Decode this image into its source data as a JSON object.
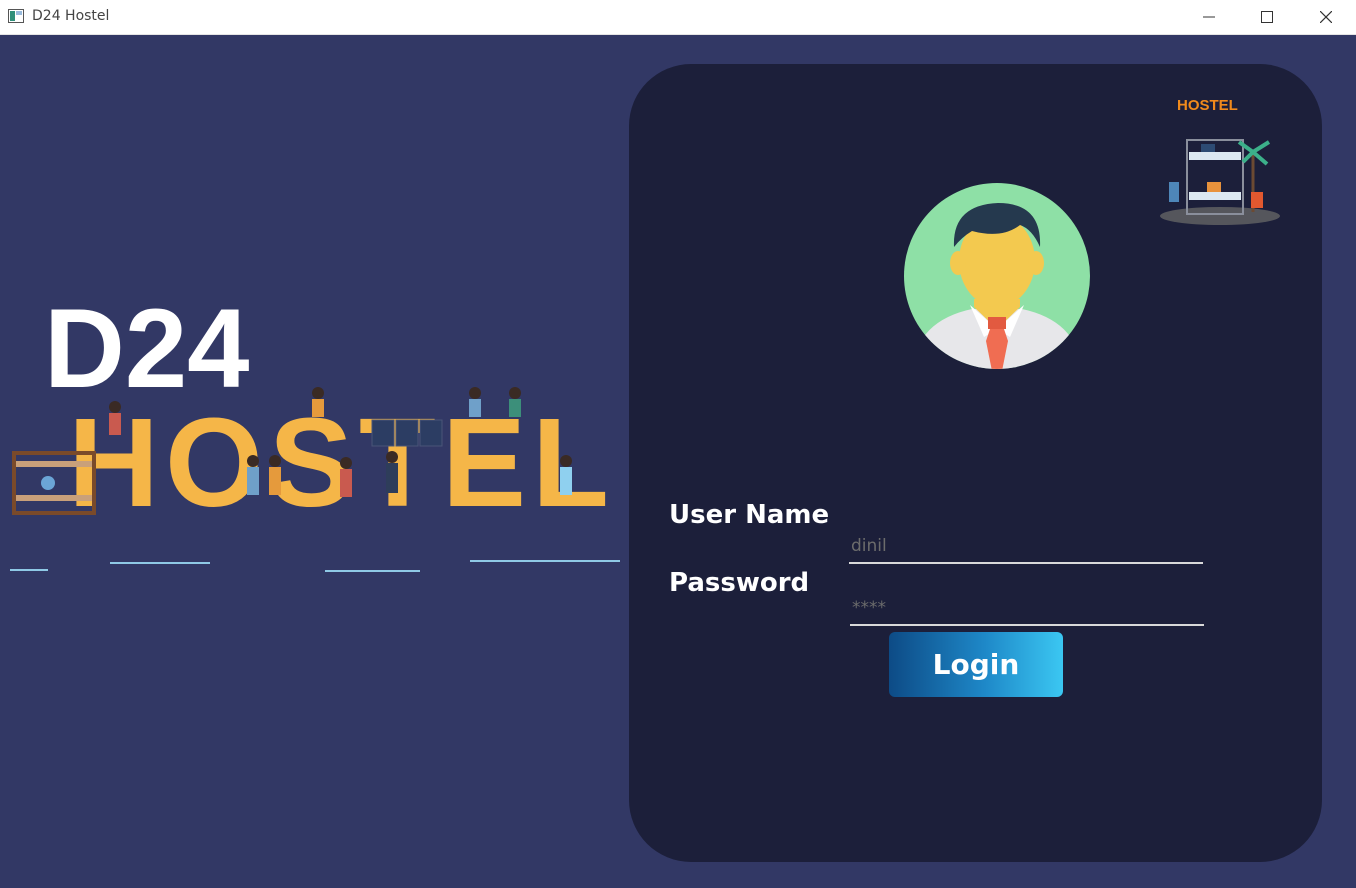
{
  "window": {
    "title": "D24 Hostel"
  },
  "hero": {
    "big_text": "D24",
    "word": "HOSTEL"
  },
  "thumbnail": {
    "label": "HOSTEL"
  },
  "login": {
    "username_label": "User Name",
    "username_value": "dinil",
    "password_label": "Password",
    "password_value": "****",
    "button_label": "Login"
  },
  "colors": {
    "background": "#323865",
    "card": "#1c1f3a",
    "accent_orange": "#f5b648",
    "avatar_circle": "#8ee0a6"
  }
}
